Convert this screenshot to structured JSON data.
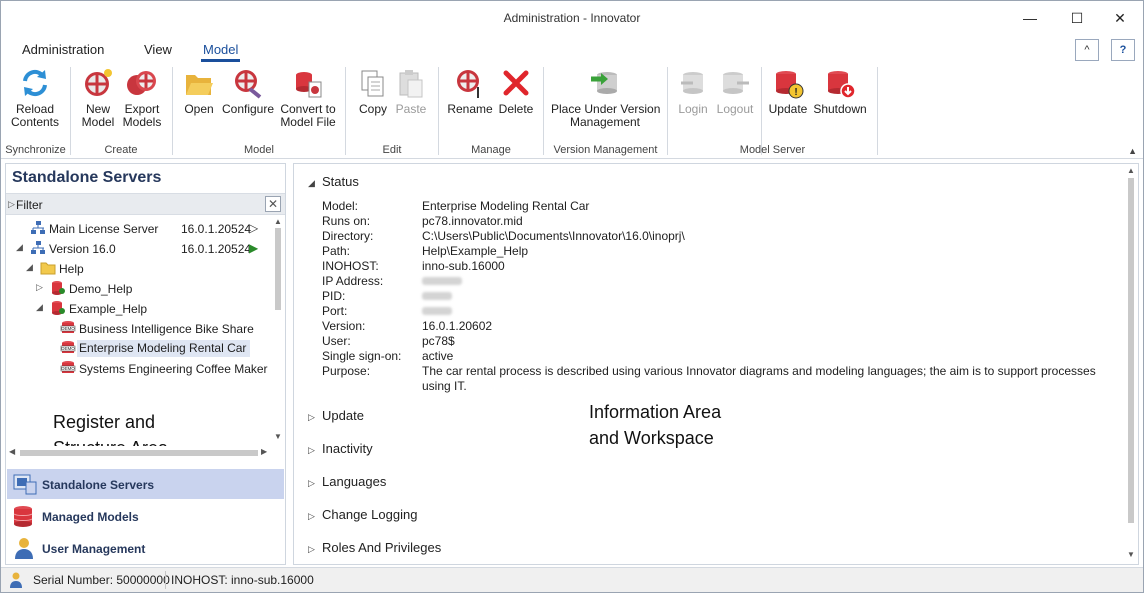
{
  "window": {
    "title": "Administration - Innovator",
    "minimize_glyph": "—",
    "maximize_glyph": "☐",
    "close_glyph": "✕"
  },
  "ribbon_tabs": [
    "Administration",
    "View",
    "Model"
  ],
  "ribbon_active_tab": "Model",
  "ribbon_right": {
    "collapse_glyph": "^",
    "help_glyph": "?"
  },
  "ribbon": {
    "reload": "Reload\nContents",
    "new_model": "New\nModel",
    "export_models": "Export\nModels",
    "open": "Open",
    "configure": "Configure",
    "convert": "Convert to\nModel File",
    "copy": "Copy",
    "paste": "Paste",
    "rename": "Rename",
    "delete": "Delete",
    "place_under_vm": "Place Under Version\nManagement",
    "login": "Login",
    "logout": "Logout",
    "update": "Update",
    "shutdown": "Shutdown",
    "groups": {
      "synchronize": "Synchronize",
      "create": "Create",
      "model": "Model",
      "edit": "Edit",
      "manage": "Manage",
      "version_management": "Version Management",
      "model_server": "Model Server"
    }
  },
  "left_panel": {
    "title": "Standalone Servers",
    "filter_label": "Filter",
    "filter_clear": "✕",
    "tree": [
      {
        "label": "Main License Server",
        "version": "16.0.1.20524",
        "arrow": "▷"
      },
      {
        "label": "Version 16.0",
        "version": "16.0.1.20524",
        "arrow": "▶"
      },
      {
        "label": "Help"
      },
      {
        "label": "Demo_Help"
      },
      {
        "label": "Example_Help"
      },
      {
        "label": "Business Intelligence Bike Share"
      },
      {
        "label": "Enterprise Modeling Rental Car"
      },
      {
        "label": "Systems Engineering Coffee Maker"
      }
    ],
    "overlay_line1": "Register and",
    "overlay_line2": "Structure Area",
    "nav": [
      {
        "label": "Standalone Servers"
      },
      {
        "label": "Managed Models"
      },
      {
        "label": "User Management"
      }
    ]
  },
  "right_panel": {
    "sections": [
      "Status",
      "Update",
      "Inactivity",
      "Languages",
      "Change Logging",
      "Roles And Privileges"
    ],
    "status": {
      "model_k": "Model:",
      "model_v": "Enterprise Modeling Rental Car",
      "runs_k": "Runs on:",
      "runs_v": "pc78.innovator.mid",
      "dir_k": "Directory:",
      "dir_v": "C:\\Users\\Public\\Documents\\Innovator\\16.0\\inoprj\\",
      "path_k": "Path:",
      "path_v": "Help\\Example_Help",
      "inohost_k": "INOHOST:",
      "inohost_v": "inno-sub.16000",
      "ip_k": "IP Address:",
      "pid_k": "PID:",
      "port_k": "Port:",
      "version_k": "Version:",
      "version_v": "16.0.1.20602",
      "user_k": "User:",
      "user_v": "pc78$",
      "sso_k": "Single sign-on:",
      "sso_v": "active",
      "purpose_k": "Purpose:",
      "purpose_v": "The car rental process is described using various Innovator diagrams and modeling languages; the aim is to support processes using IT."
    },
    "overlay_line1": "Information Area",
    "overlay_line2": "and Workspace"
  },
  "statusbar": {
    "serial": "Serial Number: 50000000",
    "inohost": "INOHOST: inno-sub.16000"
  },
  "colors": {
    "accent": "#1a4f9c",
    "nav_active": "#c9d3ee",
    "db_red": "#d9363e"
  }
}
